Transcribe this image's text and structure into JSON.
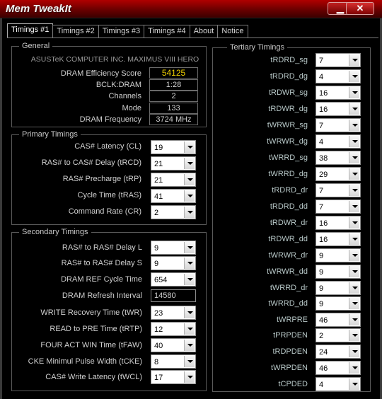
{
  "window": {
    "title": "Mem TweakIt",
    "minimize_glyph": "▁",
    "close_glyph": "✕"
  },
  "tabs": [
    "Timings #1",
    "Timings #2",
    "Timings #3",
    "Timings #4",
    "About",
    "Notice"
  ],
  "general": {
    "title": "General",
    "board": "ASUSTeK COMPUTER INC. MAXIMUS VIII HERO",
    "rows": [
      {
        "label": "DRAM Efficiency Score",
        "value": "54125"
      },
      {
        "label": "BCLK:DRAM",
        "value": "1:28"
      },
      {
        "label": "Channels",
        "value": "2"
      },
      {
        "label": "Mode",
        "value": "133"
      },
      {
        "label": "DRAM Frequency",
        "value": "3724 MHz"
      }
    ]
  },
  "primary": {
    "title": "Primary Timings",
    "rows": [
      {
        "label": "CAS# Latency (CL)",
        "value": "19"
      },
      {
        "label": "RAS# to CAS# Delay (tRCD)",
        "value": "21"
      },
      {
        "label": "RAS# Precharge (tRP)",
        "value": "21"
      },
      {
        "label": "Cycle Time (tRAS)",
        "value": "41"
      },
      {
        "label": "Command Rate (CR)",
        "value": "2"
      }
    ]
  },
  "secondary": {
    "title": "Secondary Timings",
    "rows": [
      {
        "label": "RAS# to RAS# Delay L",
        "value": "9"
      },
      {
        "label": "RAS# to RAS# Delay S",
        "value": "9"
      },
      {
        "label": "DRAM REF Cycle Time",
        "value": "654"
      },
      {
        "label": "DRAM Refresh Interval",
        "value": "14580"
      },
      {
        "label": "WRITE Recovery Time (tWR)",
        "value": "23"
      },
      {
        "label": "READ to PRE Time (tRTP)",
        "value": "12"
      },
      {
        "label": "FOUR ACT WIN Time (tFAW)",
        "value": "40"
      },
      {
        "label": "CKE Minimul Pulse Width (tCKE)",
        "value": "8"
      },
      {
        "label": "CAS# Write Latency (tWCL)",
        "value": "17"
      }
    ]
  },
  "tertiary": {
    "title": "Tertiary Timings",
    "rows": [
      {
        "label": "tRDRD_sg",
        "value": "7"
      },
      {
        "label": "tRDRD_dg",
        "value": "4"
      },
      {
        "label": "tRDWR_sg",
        "value": "16"
      },
      {
        "label": "tRDWR_dg",
        "value": "16"
      },
      {
        "label": "tWRWR_sg",
        "value": "7"
      },
      {
        "label": "tWRWR_dg",
        "value": "4"
      },
      {
        "label": "tWRRD_sg",
        "value": "38"
      },
      {
        "label": "tWRRD_dg",
        "value": "29"
      },
      {
        "label": "tRDRD_dr",
        "value": "7"
      },
      {
        "label": "tRDRD_dd",
        "value": "7"
      },
      {
        "label": "tRDWR_dr",
        "value": "16"
      },
      {
        "label": "tRDWR_dd",
        "value": "16"
      },
      {
        "label": "tWRWR_dr",
        "value": "9"
      },
      {
        "label": "tWRWR_dd",
        "value": "9"
      },
      {
        "label": "tWRRD_dr",
        "value": "9"
      },
      {
        "label": "tWRRD_dd",
        "value": "9"
      },
      {
        "label": "tWRPRE",
        "value": "46"
      },
      {
        "label": "tPRPDEN",
        "value": "2"
      },
      {
        "label": "tRDPDEN",
        "value": "24"
      },
      {
        "label": "tWRPDEN",
        "value": "46"
      },
      {
        "label": "tCPDED",
        "value": "4"
      }
    ]
  },
  "colors": {
    "title_bar": "#8a0000",
    "score": "#f0d000",
    "background": "#000000"
  },
  "icons": {
    "minimize": "minimize-icon",
    "close": "close-icon",
    "dropdown": "chevron-down-icon"
  }
}
